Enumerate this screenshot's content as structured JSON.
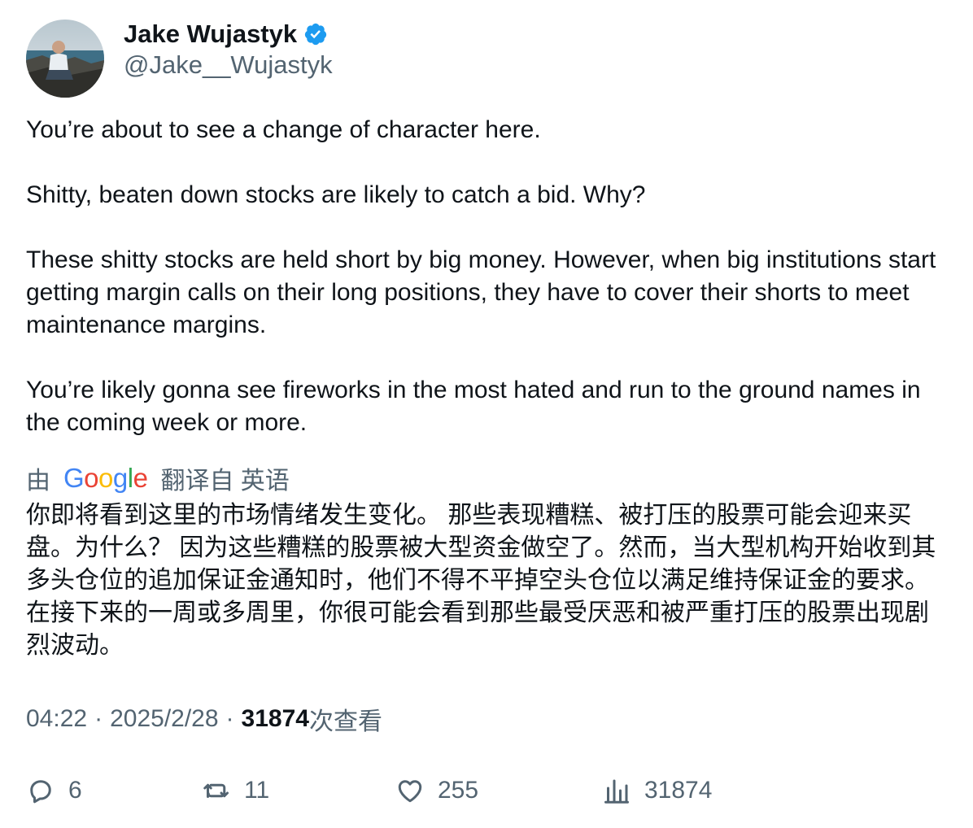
{
  "author": {
    "display_name": "Jake Wujastyk",
    "handle": "@Jake__Wujastyk",
    "verified": true
  },
  "tweet": {
    "paragraphs": [
      "You’re about to see a change of character here.",
      "Shitty, beaten down stocks are likely to catch a bid. Why?",
      "These shitty stocks are held short by big money. However, when big institutions start getting margin calls on their long positions, they have to cover their shorts to meet maintenance margins.",
      "You’re likely gonna see fireworks in the most hated and run to the ground names in the coming week or more."
    ]
  },
  "translation": {
    "by_label": "由",
    "provider_logo": "Google",
    "from_label": "翻译自 英语",
    "text": "你即将看到这里的市场情绪发生变化。 那些表现糟糕、被打压的股票可能会迎来买盘。为什么？ 因为这些糟糕的股票被大型资金做空了。然而，当大型机构开始收到其多头仓位的追加保证金通知时，他们不得不平掉空头仓位以满足维持保证金的要求。 在接下来的一周或多周里，你很可能会看到那些最受厌恶和被严重打压的股票出现剧烈波动。"
  },
  "meta": {
    "time": "04:22",
    "separator": "·",
    "date": "2025/2/28",
    "views_count": "31874",
    "views_label": "次查看"
  },
  "actions": {
    "replies": "6",
    "retweets": "11",
    "likes": "255",
    "views": "31874"
  },
  "colors": {
    "text_primary": "#0f1419",
    "text_secondary": "#536471",
    "verified_blue": "#1d9bf0"
  }
}
